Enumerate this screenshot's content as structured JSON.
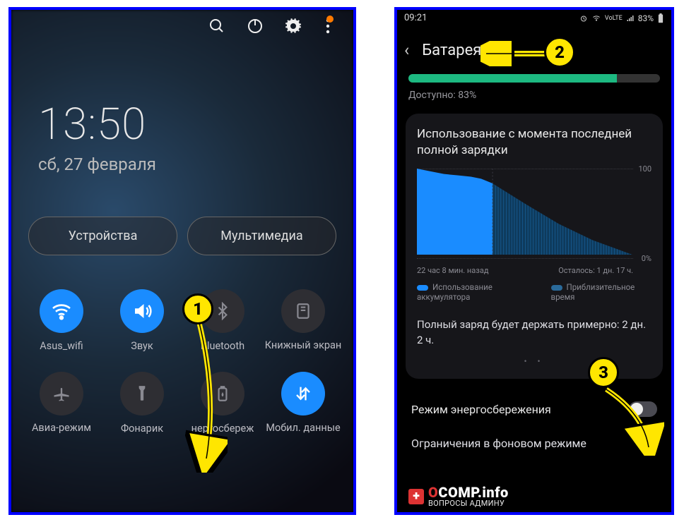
{
  "chart_data": {
    "type": "area",
    "title": "Использование с момента последней полной зарядки",
    "ylabel": "%",
    "ylim": [
      0,
      100
    ],
    "xrange_label_left": "22 час 8 мин. назад",
    "xrange_label_right": "Осталось: 1 дн. 17 ч.",
    "series": [
      {
        "name": "Использование аккумулятора",
        "x_hours": [
          0,
          2,
          5,
          8,
          11,
          14,
          17,
          20,
          22
        ],
        "values": [
          100,
          98,
          95,
          93,
          91,
          89,
          87,
          85,
          83
        ]
      },
      {
        "name": "Приблизительное время",
        "x_hours": [
          22,
          30,
          40,
          50,
          63
        ],
        "values": [
          83,
          62,
          40,
          20,
          0
        ]
      }
    ]
  },
  "annotations": {
    "b1": "1",
    "b2": "2",
    "b3": "3"
  },
  "left": {
    "clock": {
      "time": "13:50",
      "date": "сб, 27 февраля"
    },
    "pills": {
      "devices": "Устройства",
      "media": "Мультимедиа"
    },
    "tiles": [
      {
        "id": "wifi",
        "label": "Asus_wifi",
        "on": true
      },
      {
        "id": "sound",
        "label": "Звук",
        "on": true
      },
      {
        "id": "bt",
        "label": "Bluetooth",
        "on": false
      },
      {
        "id": "book",
        "label": "Книжный экран",
        "on": false
      },
      {
        "id": "airplane",
        "label": "Авиа-режим",
        "on": false
      },
      {
        "id": "torch",
        "label": "Фонарик",
        "on": false
      },
      {
        "id": "battery",
        "label": "нергосбереж",
        "on": false
      },
      {
        "id": "data",
        "label": "Мобил. данные",
        "on": true
      }
    ]
  },
  "right": {
    "status": {
      "time": "09:21",
      "battery_text": "83%"
    },
    "header": "Батарея",
    "available_label": "Доступно: 83%",
    "available_pct": 83,
    "card": {
      "title": "Использование с момента последней полной зарядки",
      "axis_left": "22 час 8 мин. назад",
      "axis_right": "Осталось: 1 дн. 17 ч.",
      "y100": "100",
      "y0": "0%",
      "legend_usage": "Использование аккумулятора",
      "legend_est": "Приблизительное время",
      "full_charge": "Полный заряд будет держать примерно: 2 дн. 2 ч.",
      "dots": "• •"
    },
    "power_saving": "Режим энергосбережения",
    "bg_restrict": "Ограничения в фоновом режиме"
  },
  "watermark": {
    "main_o": "O",
    "main_rest": "COMP.info",
    "sub": "ВОПРОСЫ АДМИНУ"
  }
}
